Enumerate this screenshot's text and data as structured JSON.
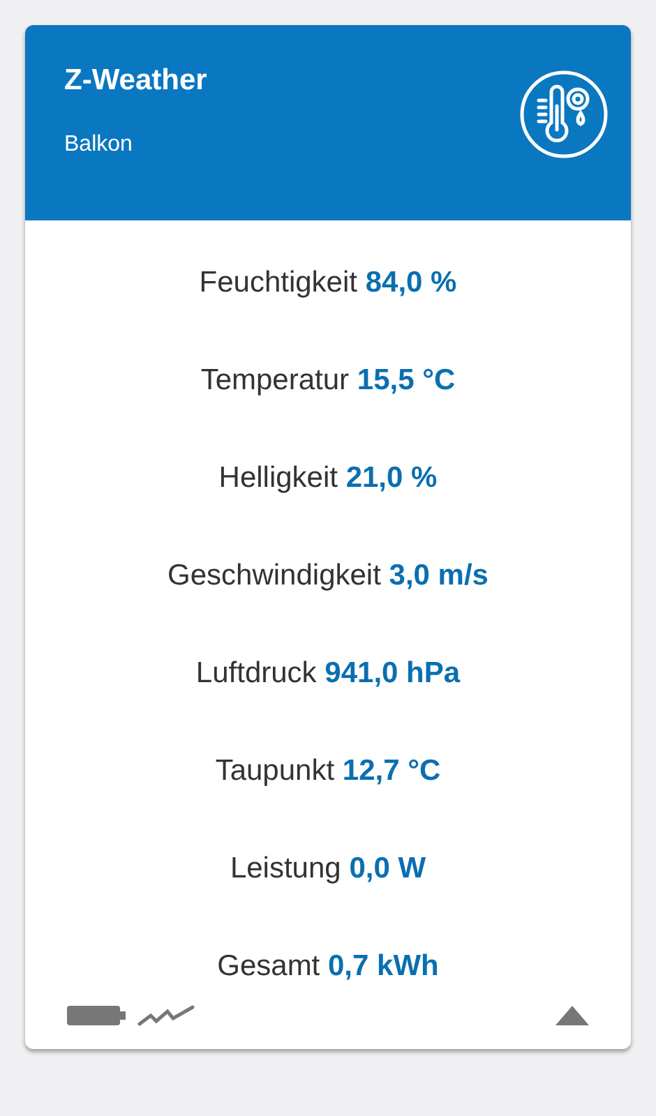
{
  "card": {
    "title": "Z-Weather",
    "subtitle": "Balkon",
    "expanded": true
  },
  "readings": [
    {
      "label": "Feuchtigkeit",
      "value": "84,0 %"
    },
    {
      "label": "Temperatur",
      "value": "15,5 °C"
    },
    {
      "label": "Helligkeit",
      "value": "21,0 %"
    },
    {
      "label": "Geschwindigkeit",
      "value": "3,0 m/s"
    },
    {
      "label": "Luftdruck",
      "value": "941,0 hPa"
    },
    {
      "label": "Taupunkt",
      "value": "12,7 °C"
    },
    {
      "label": "Leistung",
      "value": "0,0 W"
    },
    {
      "label": "Gesamt",
      "value": "0,7 kWh"
    }
  ]
}
